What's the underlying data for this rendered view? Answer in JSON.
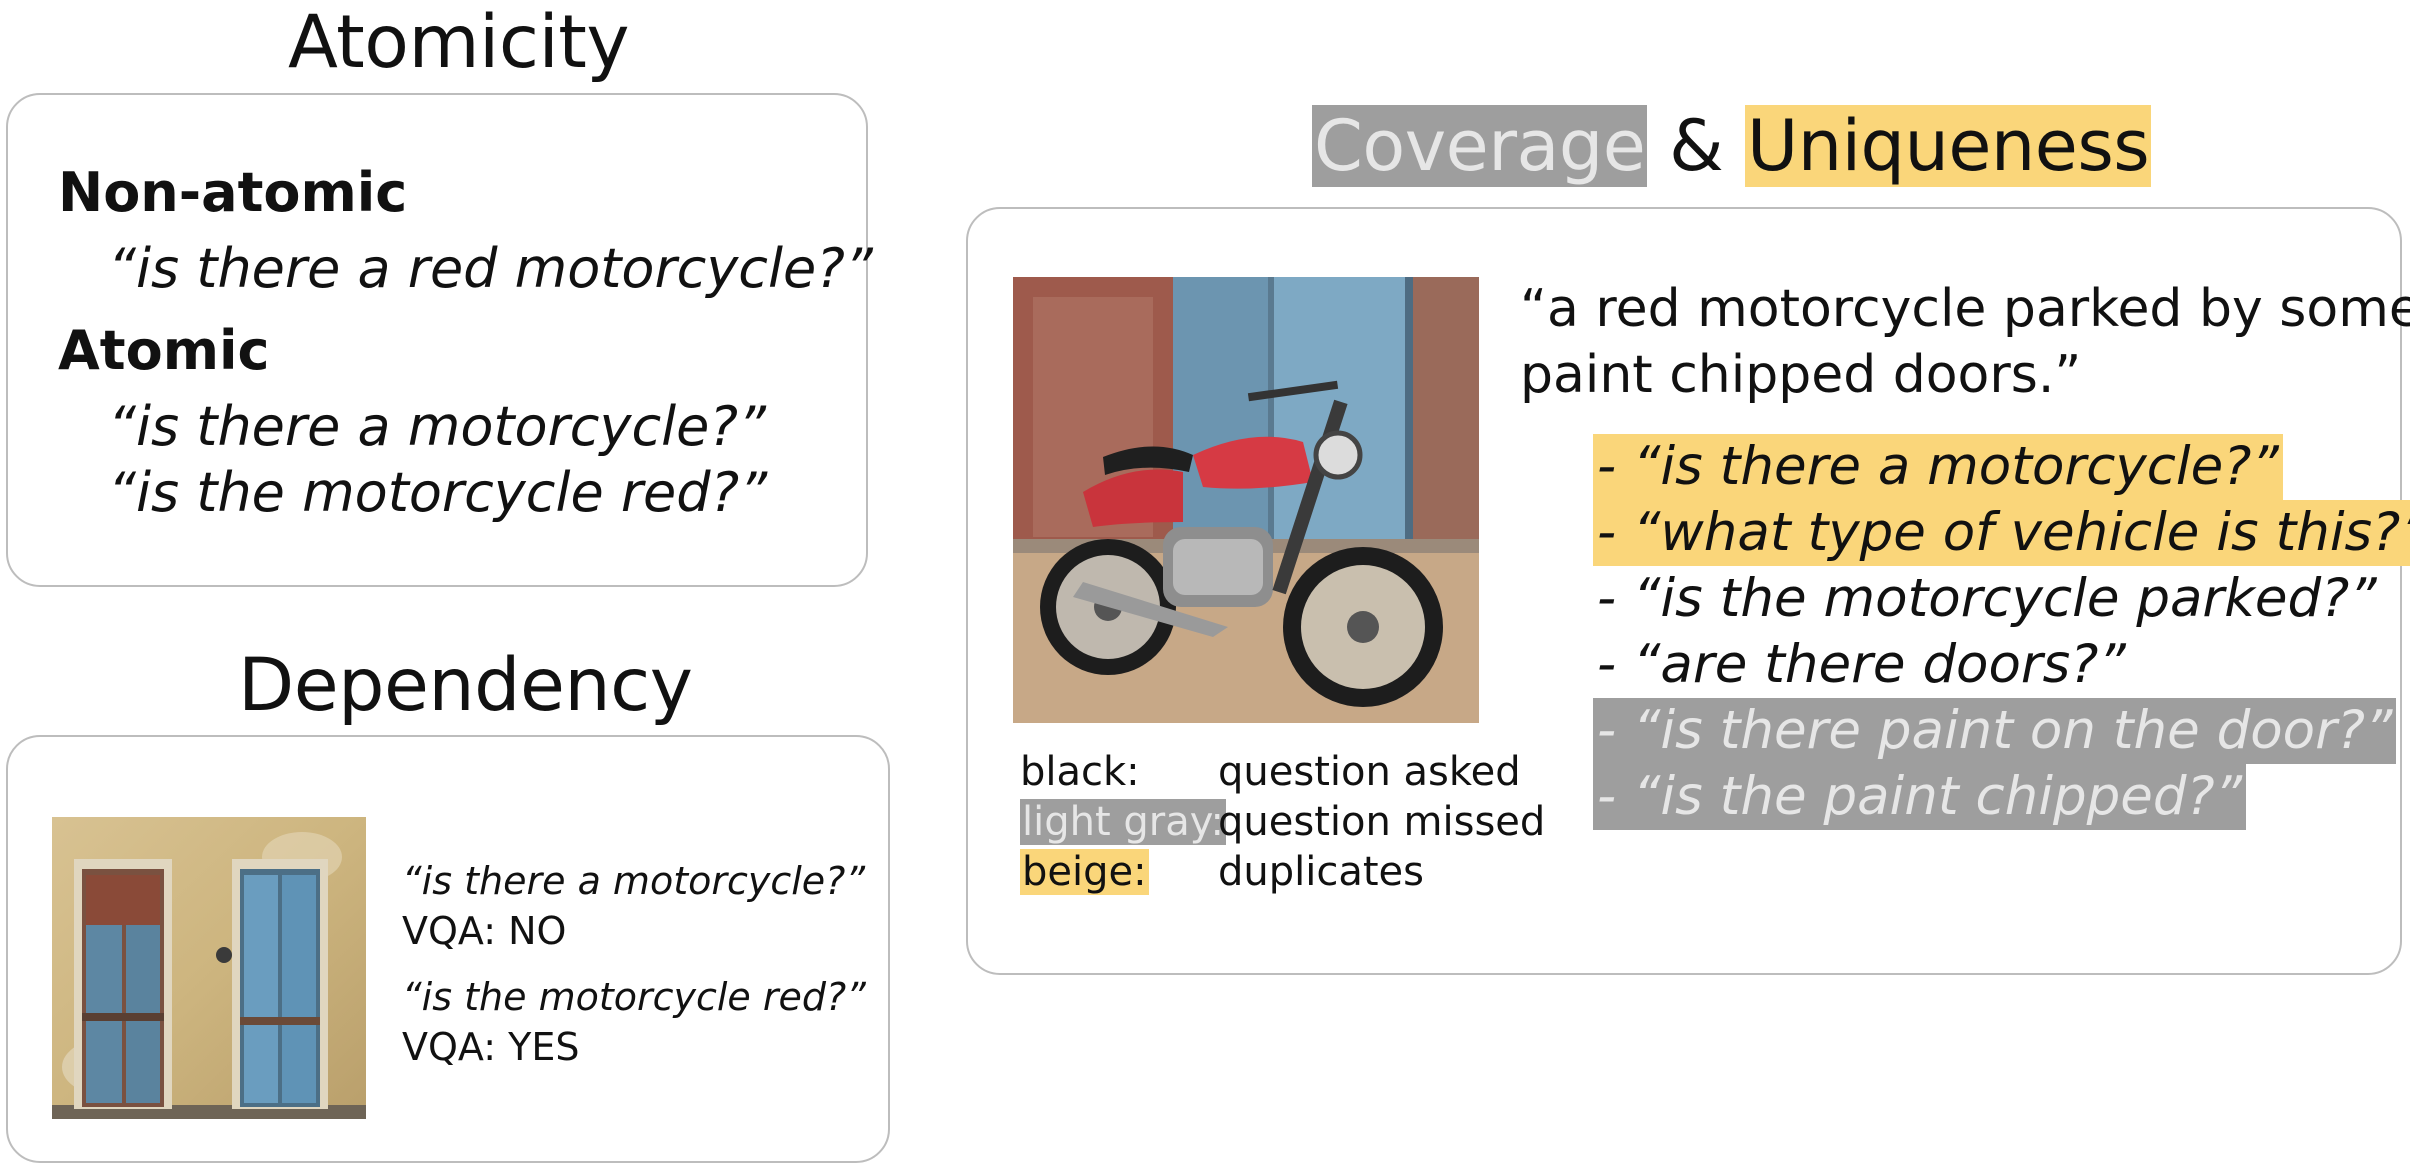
{
  "atomicity": {
    "title": "Atomicity",
    "non_atomic_label": "Non-atomic",
    "non_atomic_q": "“is there a red motorcycle?”",
    "atomic_label": "Atomic",
    "atomic_q1": "“is there a motorcycle?”",
    "atomic_q2": "“is the motorcycle red?”"
  },
  "dependency": {
    "title": "Dependency",
    "q1": "“is there a motorcycle?”",
    "a1": "VQA: NO",
    "q2": "“is the motorcycle red?”",
    "a2": "VQA: YES"
  },
  "coverage": {
    "title_part1": "Coverage",
    "title_amp": " & ",
    "title_part2": "Uniqueness",
    "caption_line1": "“a red motorcycle parked by some",
    "caption_line2": "paint chipped doors.”",
    "questions": [
      {
        "text": "- “is there a motorcycle?”",
        "status": "duplicate"
      },
      {
        "text": "- “what type of vehicle is this?”",
        "status": "duplicate"
      },
      {
        "text": "- “is the motorcycle parked?”",
        "status": "asked"
      },
      {
        "text": "- “are there doors?”",
        "status": "asked"
      },
      {
        "text": "- “is there paint on the door?”",
        "status": "missed"
      },
      {
        "text": "- “is the paint chipped?”",
        "status": "missed"
      }
    ],
    "legend": [
      {
        "key": "black:",
        "value": "question asked",
        "style": "asked"
      },
      {
        "key": "light gray:",
        "value": "question missed",
        "style": "missed"
      },
      {
        "key": "beige:",
        "value": "duplicates",
        "style": "duplicate"
      }
    ]
  },
  "colors": {
    "beige": "#fad67a",
    "gray": "#9e9e9e",
    "light_gray_text": "#e6e6e6",
    "border": "#bdbdbd"
  }
}
